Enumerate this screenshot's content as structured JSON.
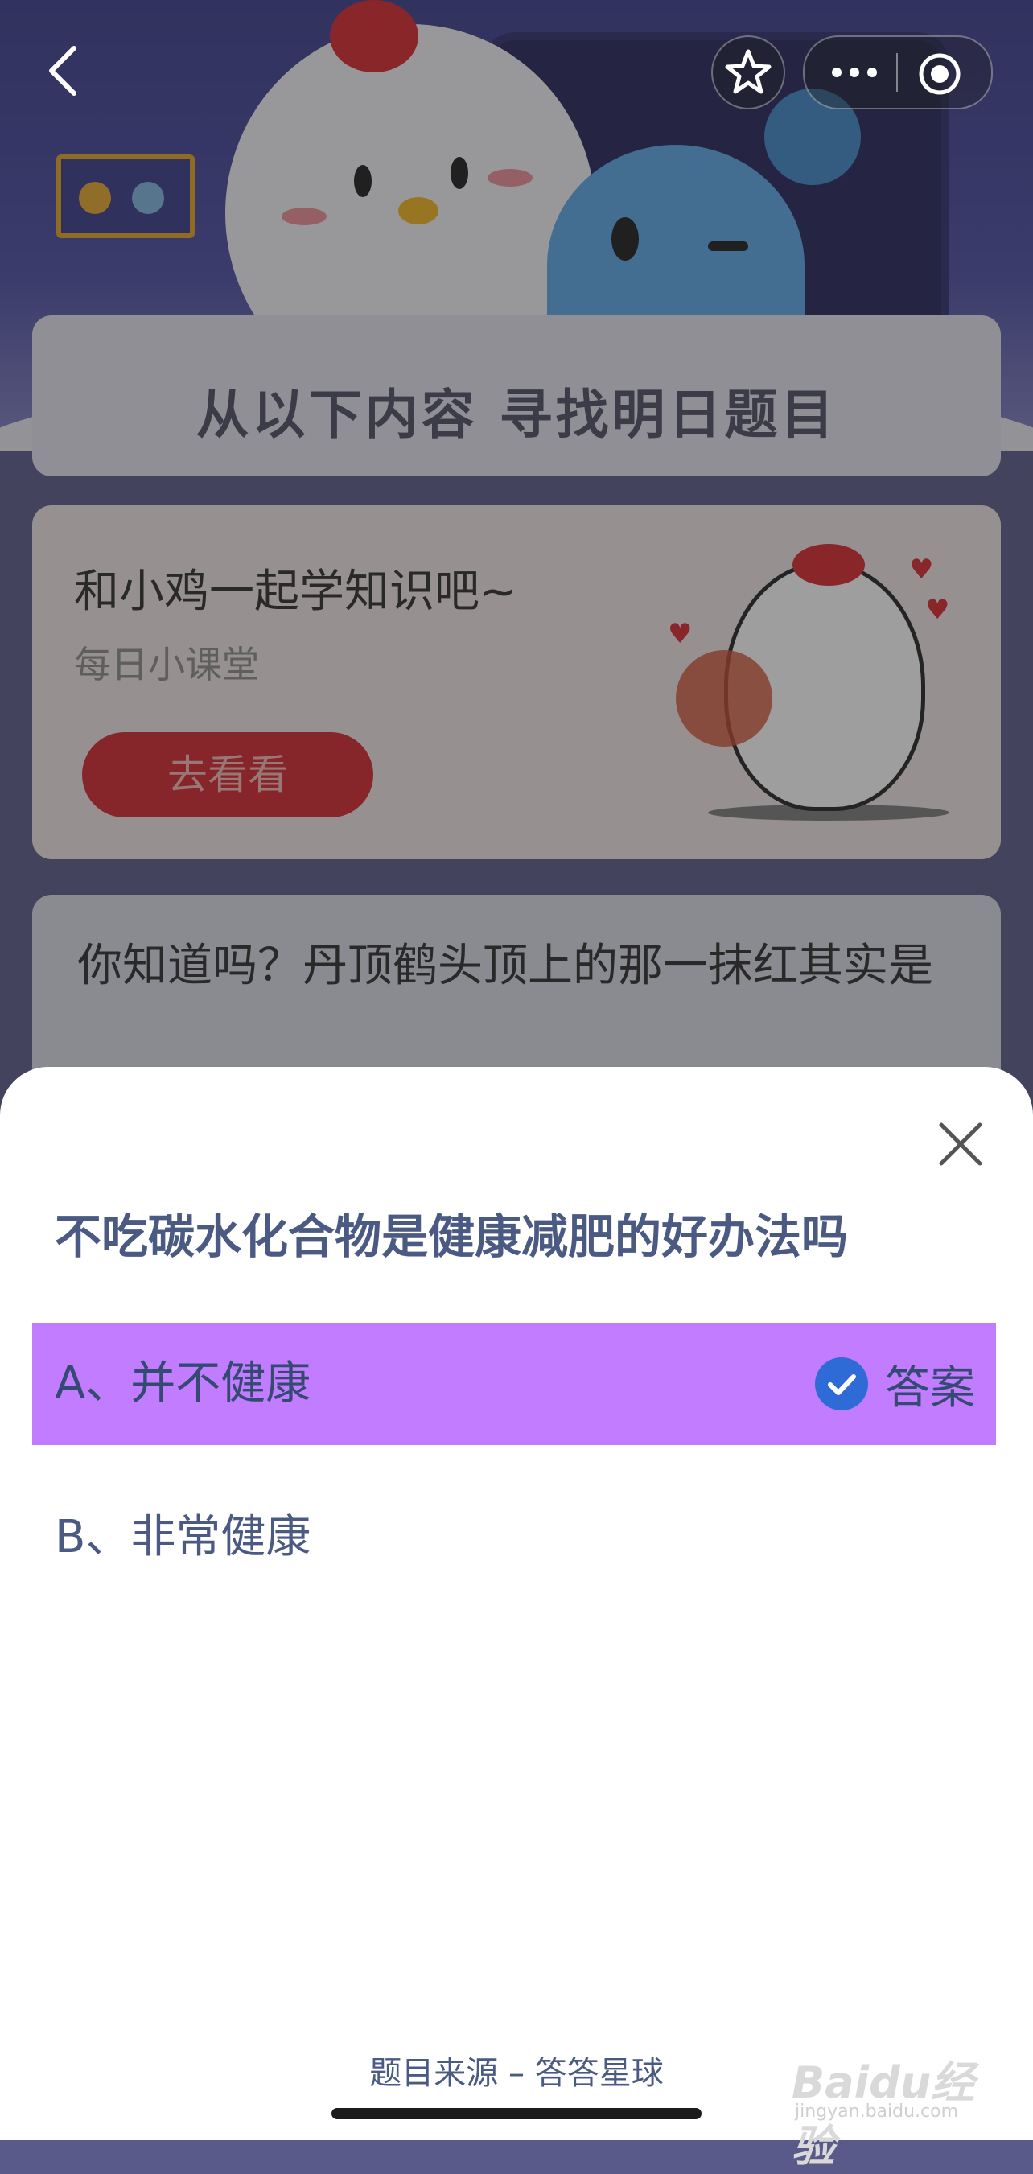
{
  "hunt_card": {
    "title": "从以下内容 寻找明日题目"
  },
  "class_card": {
    "title": "和小鸡一起学知识吧~",
    "subtitle": "每日小课堂",
    "button_label": "去看看"
  },
  "know_card": {
    "text": "你知道吗？丹顶鹤头顶上的那一抹红其实是"
  },
  "icons": {
    "back": "chevron-left-icon",
    "star": "star-icon",
    "more": "more-dots-icon",
    "target": "record-target-icon",
    "close": "close-icon",
    "check": "check-circle-icon"
  },
  "sheet": {
    "question": "不吃碳水化合物是健康减肥的好办法吗",
    "options": [
      {
        "label": "A、并不健康",
        "correct": true,
        "answer_tag": "答案"
      },
      {
        "label": "B、非常健康",
        "correct": false
      }
    ],
    "source": "题目来源 – 答答星球"
  },
  "watermark": {
    "main": "Baidu经验",
    "sub": "jingyan.baidu.com"
  },
  "colors": {
    "accent_option": "#c17cff",
    "question_text": "#4b5a83",
    "check_fill": "#2f6bd6",
    "button_red": "#d6262c"
  }
}
